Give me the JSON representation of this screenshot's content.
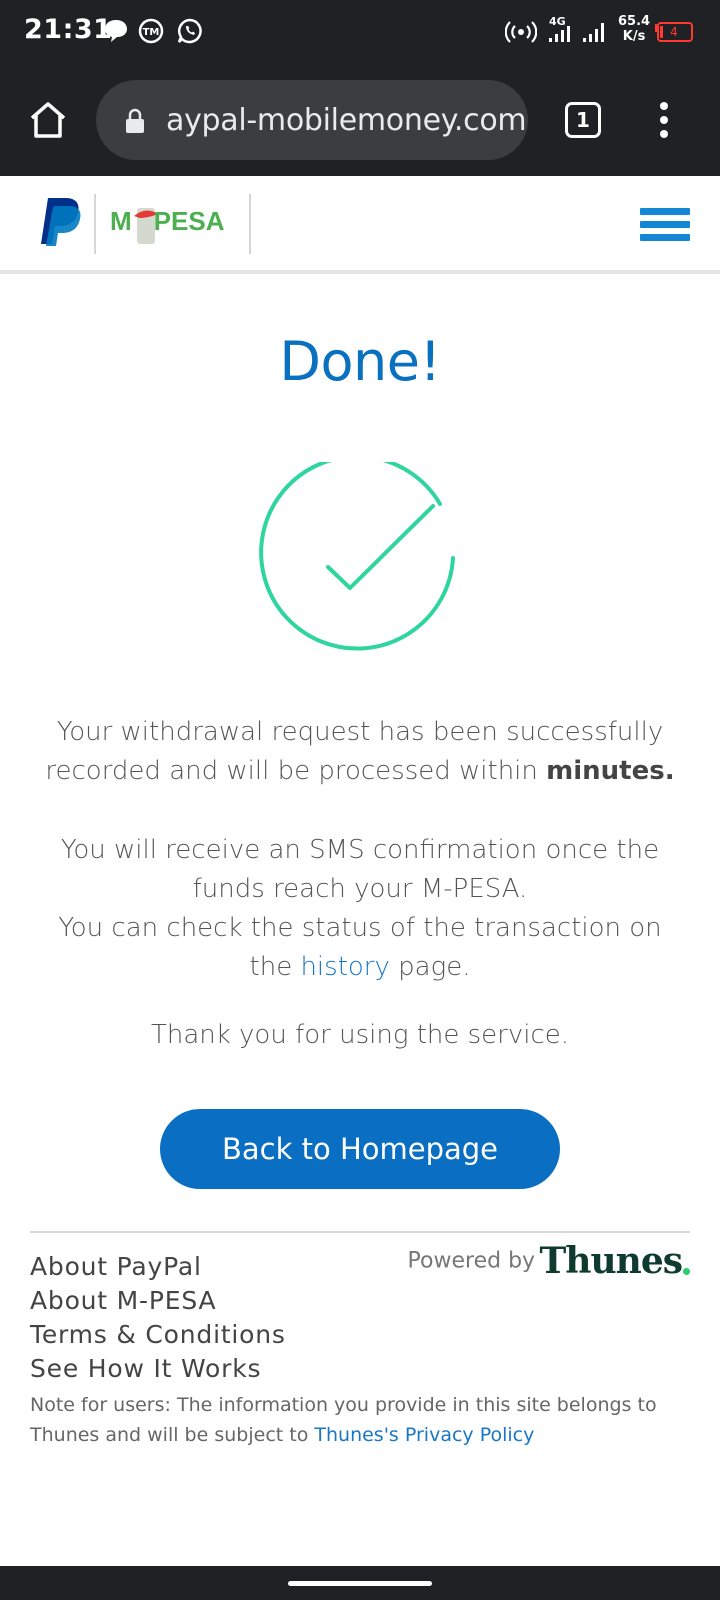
{
  "status_bar": {
    "time": "21:31",
    "network": "4G",
    "speed_value": "65.4",
    "speed_unit": "K/s",
    "battery": "4",
    "notification_icons": [
      "chat-bubble-icon",
      "tm-icon",
      "whatsapp-icon"
    ],
    "colors": {
      "background": "#202124",
      "battery_low": "#ff3b30"
    }
  },
  "browser": {
    "url": "aypal-mobilemoney.com",
    "tab_count": "1"
  },
  "header": {
    "brand_1": "PayPal",
    "brand_2": "M-PESA",
    "mpesa_prefix": "M",
    "mpesa_suffix": "PESA",
    "colors": {
      "paypal_dark": "#003087",
      "paypal_light": "#0079c1",
      "mpesa_green": "#4caf50",
      "menu_blue": "#1386d6"
    }
  },
  "main": {
    "title": "Done!",
    "message_1_part1": "Your withdrawal request has been successfully recorded and will be processed within ",
    "message_1_bold": "minutes.",
    "message_2": "You will receive an SMS confirmation once the funds reach your M-PESA.",
    "message_3_part1": "You can check the status of the transaction on the ",
    "message_3_link": "history",
    "message_3_part2": " page.",
    "thanks": "Thank you for using the service.",
    "button_label": "Back to Homepage",
    "colors": {
      "title": "#0a70c0",
      "check": "#2ed69c",
      "button": "#0a6fc2"
    }
  },
  "footer": {
    "links": [
      "About PayPal",
      "About M-PESA",
      "Terms & Conditions",
      "See How It Works"
    ],
    "powered_label": "Powered by",
    "powered_brand": "Thunes",
    "note_part1": "Note for users: The information you provide in this site belongs to Thunes and will be subject to ",
    "note_link": "Thunes's Privacy Policy"
  }
}
